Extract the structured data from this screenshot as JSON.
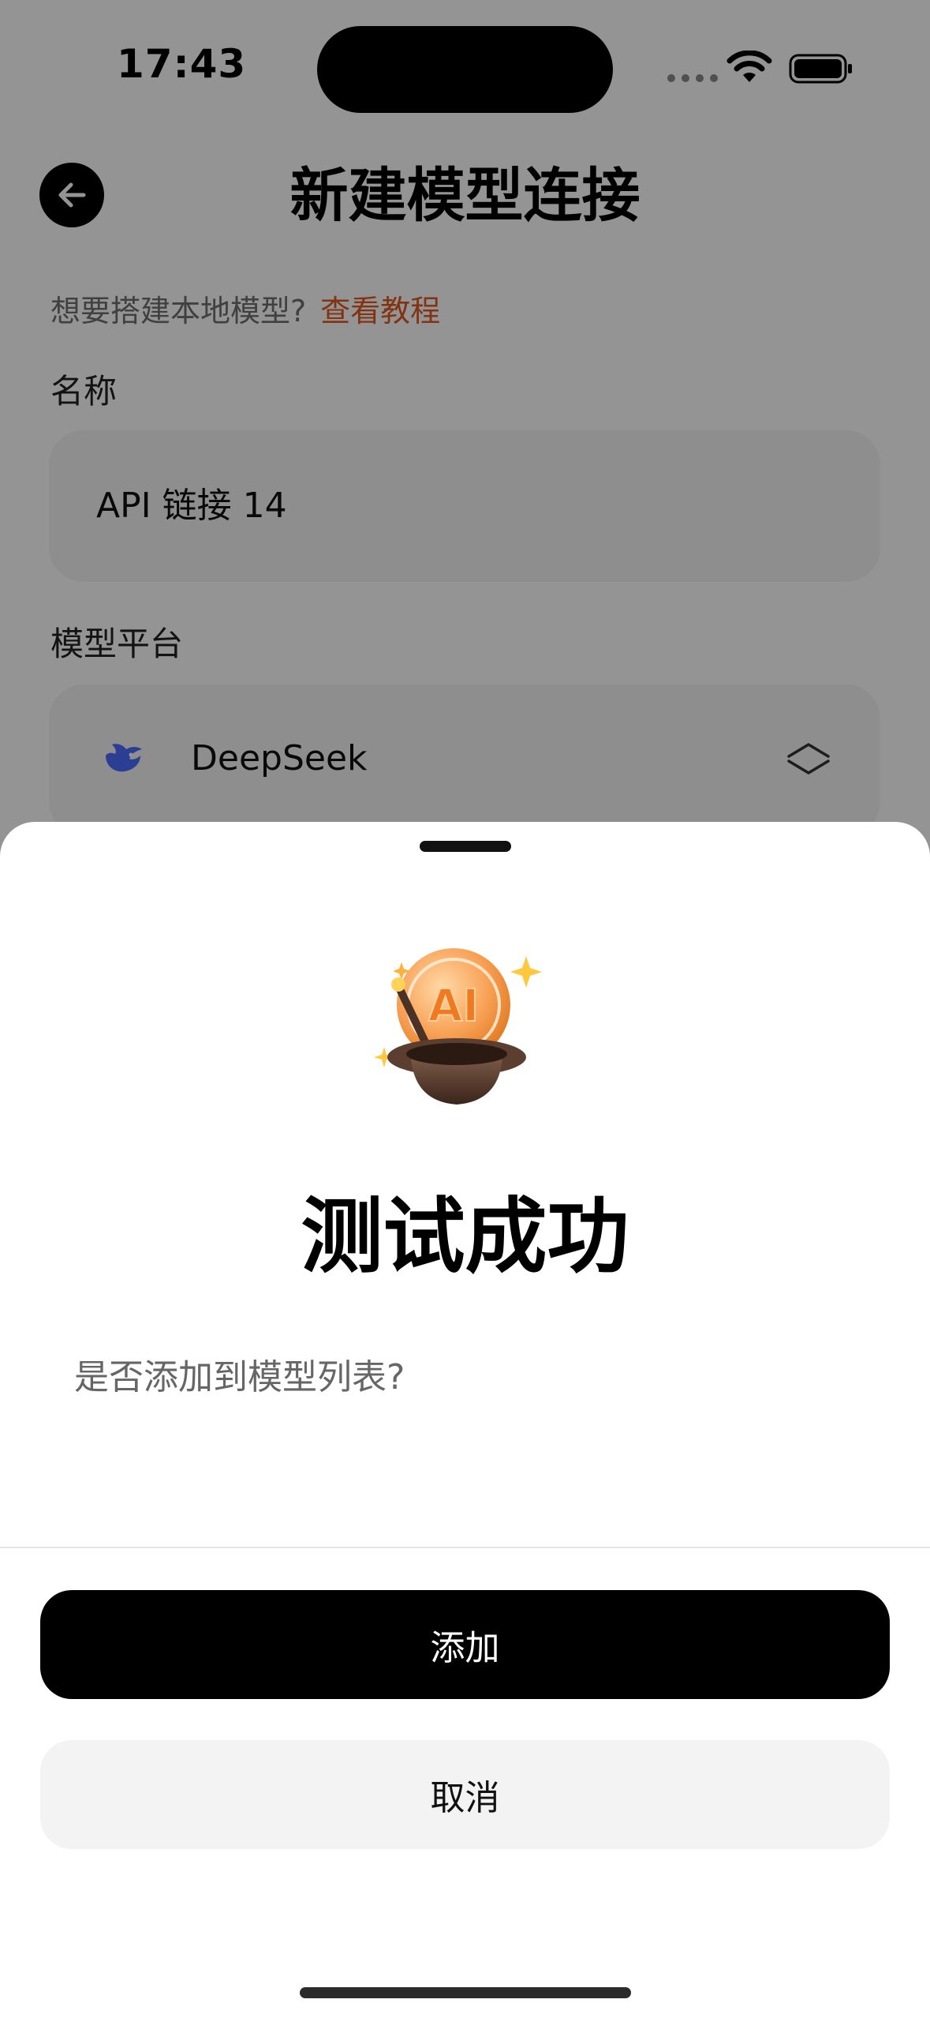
{
  "status_bar": {
    "time": "17:43"
  },
  "header": {
    "title": "新建模型连接",
    "back_icon": "arrow-left-icon"
  },
  "hint": {
    "text": "想要搭建本地模型?",
    "link": "查看教程"
  },
  "form": {
    "name_label": "名称",
    "name_value": "API 链接 14",
    "platform_label": "模型平台",
    "platform_value": "DeepSeek",
    "platform_icon": "deepseek-whale-icon"
  },
  "sheet": {
    "title": "测试成功",
    "message": "是否添加到模型列表?",
    "primary_button": "添加",
    "secondary_button": "取消",
    "illustration": "ai-magic-hat-icon",
    "illustration_text": "AI"
  },
  "colors": {
    "accent_link": "#e0581f",
    "primary_button": "#000000",
    "secondary_button": "#f3f3f3",
    "deepseek_blue": "#4d6bfe"
  }
}
